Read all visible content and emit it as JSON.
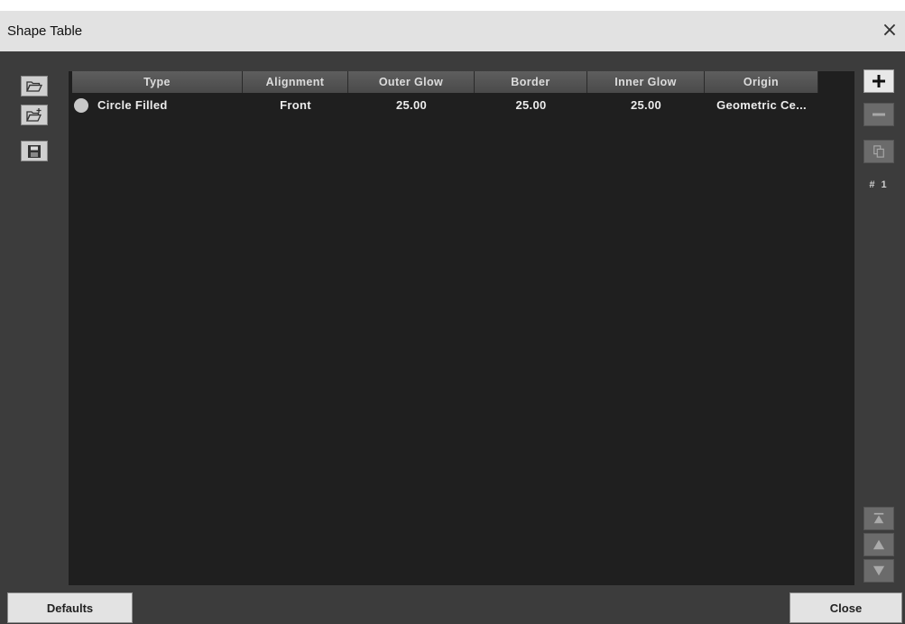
{
  "window": {
    "title": "Shape Table",
    "close_glyph": "×"
  },
  "left_toolbar": [
    {
      "name": "open-folder-icon"
    },
    {
      "name": "open-folder-add-icon"
    },
    {
      "name": "save-icon"
    }
  ],
  "table": {
    "columns": [
      "Type",
      "Alignment",
      "Outer Glow",
      "Border",
      "Inner Glow",
      "Origin"
    ],
    "rows": [
      {
        "type": "Circle Filled",
        "alignment": "Front",
        "outer_glow": "25.00",
        "border": "25.00",
        "inner_glow": "25.00",
        "origin": "Geometric Ce..."
      }
    ]
  },
  "right_toolbar": {
    "add_glyph": "+",
    "remove_glyph": "—",
    "counter": "# 1"
  },
  "footer": {
    "defaults_label": "Defaults",
    "close_label": "Close"
  },
  "colors": {
    "background": "#3c3c3c",
    "table_bg": "#1f1f1f",
    "titlebar": "#e2e2e2"
  }
}
